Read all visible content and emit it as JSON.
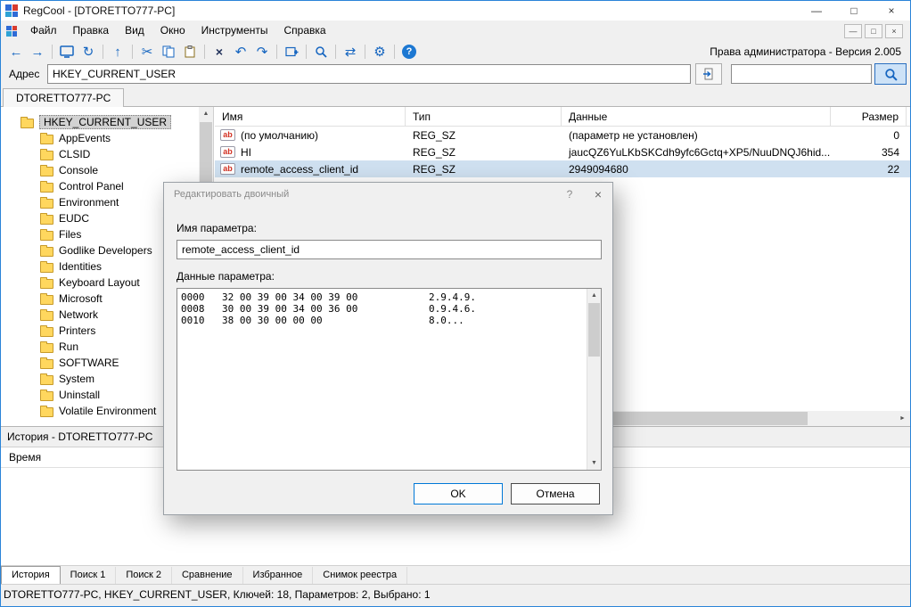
{
  "titlebar": {
    "title": "RegCool - [DTORETTO777-PC]"
  },
  "menubar": {
    "items": [
      "Файл",
      "Правка",
      "Вид",
      "Окно",
      "Инструменты",
      "Справка"
    ]
  },
  "toolbar": {
    "admin_label": "Права администратора - Версия 2.005"
  },
  "addressbar": {
    "label": "Адрес",
    "value": "HKEY_CURRENT_USER",
    "search_value": ""
  },
  "tabs": {
    "main_tab": "DTORETTO777-PC"
  },
  "tree": {
    "root": "HKEY_CURRENT_USER",
    "items": [
      "AppEvents",
      "CLSID",
      "Console",
      "Control Panel",
      "Environment",
      "EUDC",
      "Files",
      "Godlike Developers",
      "Identities",
      "Keyboard Layout",
      "Microsoft",
      "Network",
      "Printers",
      "Run",
      "SOFTWARE",
      "System",
      "Uninstall",
      "Volatile Environment"
    ]
  },
  "list": {
    "columns": [
      "Имя",
      "Тип",
      "Данные",
      "Размер"
    ],
    "rows": [
      {
        "name": "(по умолчанию)",
        "type": "REG_SZ",
        "data": "(параметр не установлен)",
        "size": "0"
      },
      {
        "name": "HI",
        "type": "REG_SZ",
        "data": "jaucQZ6YuLKbSKCdh9yfc6Gctq+XP5/NuuDNQJ6hid...",
        "size": "354"
      },
      {
        "name": "remote_access_client_id",
        "type": "REG_SZ",
        "data": "2949094680",
        "size": "22"
      }
    ]
  },
  "dialog": {
    "title": "Редактировать двоичный",
    "name_label": "Имя параметра:",
    "name_value": "remote_access_client_id",
    "data_label": "Данные параметра:",
    "hex_rows": [
      {
        "offset": "0000",
        "hex": "32 00 39 00 34 00 39 00",
        "ascii": "2.9.4.9."
      },
      {
        "offset": "0008",
        "hex": "30 00 39 00 34 00 36 00",
        "ascii": "0.9.4.6."
      },
      {
        "offset": "0010",
        "hex": "38 00 30 00 00 00",
        "ascii": "8.0..."
      }
    ],
    "ok_label": "OK",
    "cancel_label": "Отмена"
  },
  "history": {
    "header": "История - DTORETTO777-PC",
    "column": "Время"
  },
  "bottom_tabs": [
    "История",
    "Поиск 1",
    "Поиск 2",
    "Сравнение",
    "Избранное",
    "Снимок реестра"
  ],
  "statusbar": {
    "text": "DTORETTO777-PC, HKEY_CURRENT_USER, Ключей: 18, Параметров: 2, Выбрано: 1"
  },
  "colors": {
    "accent": "#1565c0",
    "window_border": "#2a84d8",
    "folder": "#ffd75e",
    "selection": "#cfe0f0"
  },
  "icons": {
    "back": "←",
    "forward": "→",
    "up": "↑",
    "refresh": "↻",
    "cut": "✂",
    "delete": "×",
    "undo": "↶",
    "redo": "↷",
    "sync": "⇄",
    "gear": "⚙",
    "help": "?",
    "ab": "ab",
    "minimize": "—",
    "maximize": "□",
    "close": "×",
    "mdi_minimize": "—",
    "mdi_restore": "□",
    "mdi_close": "×",
    "dialog_help": "?",
    "dialog_close": "×",
    "arrow_up": "▲",
    "arrow_down": "▼",
    "arrow_left": "◄",
    "arrow_right": "►"
  }
}
